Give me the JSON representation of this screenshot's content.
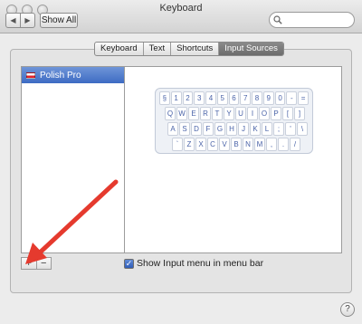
{
  "window": {
    "title": "Keyboard"
  },
  "toolbar": {
    "back_label": "◀",
    "forward_label": "▶",
    "show_all_label": "Show All",
    "search": {
      "placeholder": "",
      "value": ""
    }
  },
  "tabs": [
    {
      "label": "Keyboard",
      "selected": false
    },
    {
      "label": "Text",
      "selected": false
    },
    {
      "label": "Shortcuts",
      "selected": false
    },
    {
      "label": "Input Sources",
      "selected": true
    }
  ],
  "sources": {
    "items": [
      {
        "label": "Polish Pro",
        "selected": true
      }
    ],
    "add_label": "+",
    "remove_label": "−"
  },
  "keyboard_preview": {
    "rows": [
      [
        "§",
        "1",
        "2",
        "3",
        "4",
        "5",
        "6",
        "7",
        "8",
        "9",
        "0",
        "-",
        "="
      ],
      [
        "Q",
        "W",
        "E",
        "R",
        "T",
        "Y",
        "U",
        "I",
        "O",
        "P",
        "[",
        "]"
      ],
      [
        "A",
        "S",
        "D",
        "F",
        "G",
        "H",
        "J",
        "K",
        "L",
        ";",
        "'",
        "\\"
      ],
      [
        "`",
        "Z",
        "X",
        "C",
        "V",
        "B",
        "N",
        "M",
        ",",
        ".",
        "/"
      ]
    ]
  },
  "options": {
    "show_input_menu_label": "Show Input menu in menu bar",
    "show_input_menu_checked": true
  },
  "help_label": "?",
  "colors": {
    "selection": "#3d6bc3",
    "key_text": "#4a63a8",
    "arrow": "#e53a2e"
  }
}
